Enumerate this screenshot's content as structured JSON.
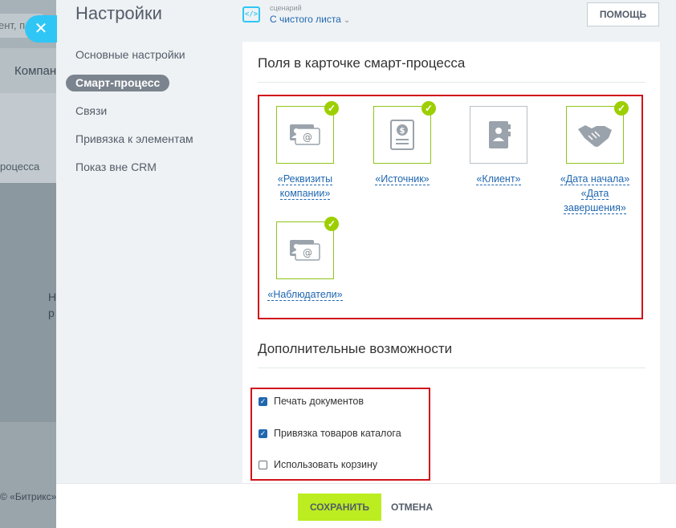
{
  "background": {
    "search_fragment": "ент, п",
    "band_fragment": "Компан",
    "row_fragment": "роцесса",
    "text_fragment_1": "Н",
    "text_fragment_2": "р",
    "footer_fragment": "© «Битрикс»"
  },
  "close_button": {
    "icon": "close-icon",
    "glyph": "✕"
  },
  "slider": {
    "title": "Настройки",
    "scenario": {
      "caption": "сценарий",
      "value": "С чистого листа",
      "chevron": "⌄"
    },
    "help_label": "ПОМОЩЬ"
  },
  "menu": {
    "items": [
      {
        "label": "Основные настройки",
        "active": false
      },
      {
        "label": "Смарт-процесс",
        "active": true
      },
      {
        "label": "Связи",
        "active": false
      },
      {
        "label": "Привязка к элементам",
        "active": false
      },
      {
        "label": "Показ вне CRM",
        "active": false
      }
    ]
  },
  "fields_section": {
    "title": "Поля в карточке смарт-процесса",
    "fields": [
      {
        "label": "«Реквизиты компании»",
        "icon": "requisites-icon",
        "checked": true
      },
      {
        "label": "«Источник»",
        "icon": "source-icon",
        "checked": true
      },
      {
        "label": "«Клиент»",
        "icon": "client-icon",
        "checked": false
      },
      {
        "label": "«Дата начала» «Дата завершения»",
        "icon": "handshake-icon",
        "checked": true
      },
      {
        "label": "«Наблюдатели»",
        "icon": "observers-icon",
        "checked": true
      }
    ],
    "check_glyph": "✓"
  },
  "extra_section": {
    "title": "Дополнительные возможности",
    "options": [
      {
        "label": "Печать документов",
        "checked": true
      },
      {
        "label": "Привязка товаров каталога",
        "checked": true
      },
      {
        "label": "Использовать корзину",
        "checked": false
      }
    ]
  },
  "footer": {
    "save_label": "СОХРАНИТЬ",
    "cancel_label": "ОТМЕНА"
  },
  "colors": {
    "accent_blue": "#2fc6f6",
    "link_blue": "#2067b0",
    "check_green": "#9dcf00",
    "save_green": "#bbed21",
    "highlight_red": "#d0131b"
  }
}
